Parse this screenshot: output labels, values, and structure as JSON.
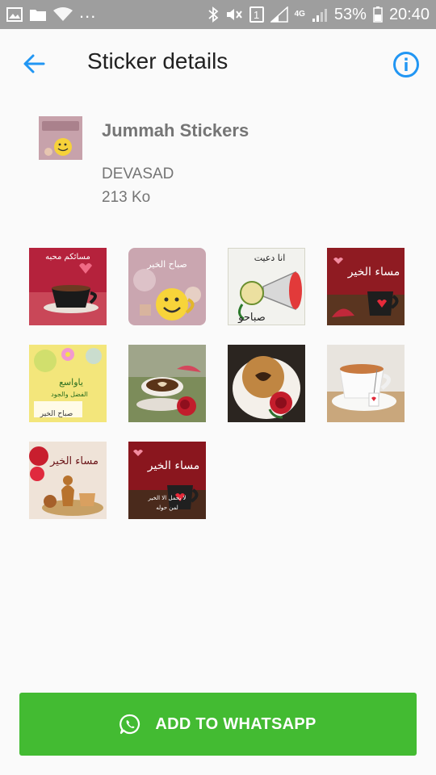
{
  "status_bar": {
    "battery_percent": "53%",
    "time": "20:40",
    "sim_slot": "1",
    "network": "4G",
    "overflow": "...",
    "left_icons": [
      "image-icon",
      "folder-icon",
      "wifi-icon"
    ],
    "right_icons": [
      "bluetooth-icon",
      "mute-icon",
      "sim-icon",
      "signal-icon",
      "signal-icon",
      "battery-icon"
    ]
  },
  "toolbar": {
    "title": "Sticker details",
    "back_icon": "arrow-back-icon",
    "info_icon": "info-icon"
  },
  "pack": {
    "name": "Jummah Stickers",
    "publisher": "DEVASAD",
    "size": "213 Ko"
  },
  "stickers": [
    {
      "caption": "مسائكم محبه"
    },
    {
      "caption": "صباح الخير"
    },
    {
      "caption": "صباحو"
    },
    {
      "caption": "مساء الخير"
    },
    {
      "caption": "صباح الخير"
    },
    {
      "caption": ""
    },
    {
      "caption": ""
    },
    {
      "caption": ""
    },
    {
      "caption": "مساء الخير"
    },
    {
      "caption": "مساء الخير"
    }
  ],
  "add_button": {
    "label": "ADD TO WHATSAPP",
    "icon": "whatsapp-icon"
  },
  "colors": {
    "accent": "#2196f3",
    "button_green": "#43bb32",
    "status_bar": "#9e9e9e"
  }
}
